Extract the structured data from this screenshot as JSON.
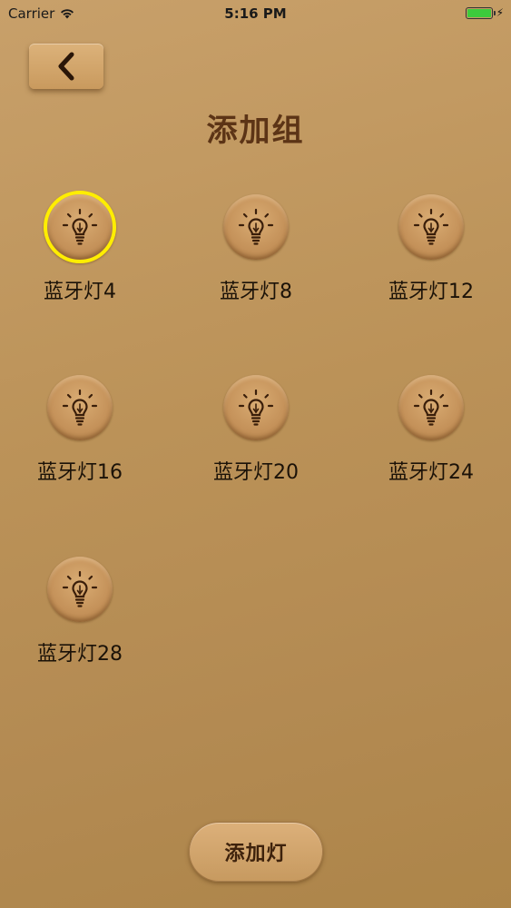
{
  "status_bar": {
    "carrier": "Carrier",
    "time": "5:16 PM",
    "battery_color": "#3ccb3c"
  },
  "header": {
    "back_icon": "chevron-left-icon",
    "title": "添加组"
  },
  "lamps": [
    {
      "label": "蓝牙灯4",
      "selected": true,
      "icon": "lightbulb-icon"
    },
    {
      "label": "蓝牙灯8",
      "selected": false,
      "icon": "lightbulb-icon"
    },
    {
      "label": "蓝牙灯12",
      "selected": false,
      "icon": "lightbulb-icon"
    },
    {
      "label": "蓝牙灯16",
      "selected": false,
      "icon": "lightbulb-icon"
    },
    {
      "label": "蓝牙灯20",
      "selected": false,
      "icon": "lightbulb-icon"
    },
    {
      "label": "蓝牙灯24",
      "selected": false,
      "icon": "lightbulb-icon"
    },
    {
      "label": "蓝牙灯28",
      "selected": false,
      "icon": "lightbulb-icon"
    }
  ],
  "footer": {
    "add_lamp_label": "添加灯"
  },
  "colors": {
    "selected_ring": "#ffee00",
    "title": "#5c3416",
    "icon": "#3a1e0a"
  }
}
